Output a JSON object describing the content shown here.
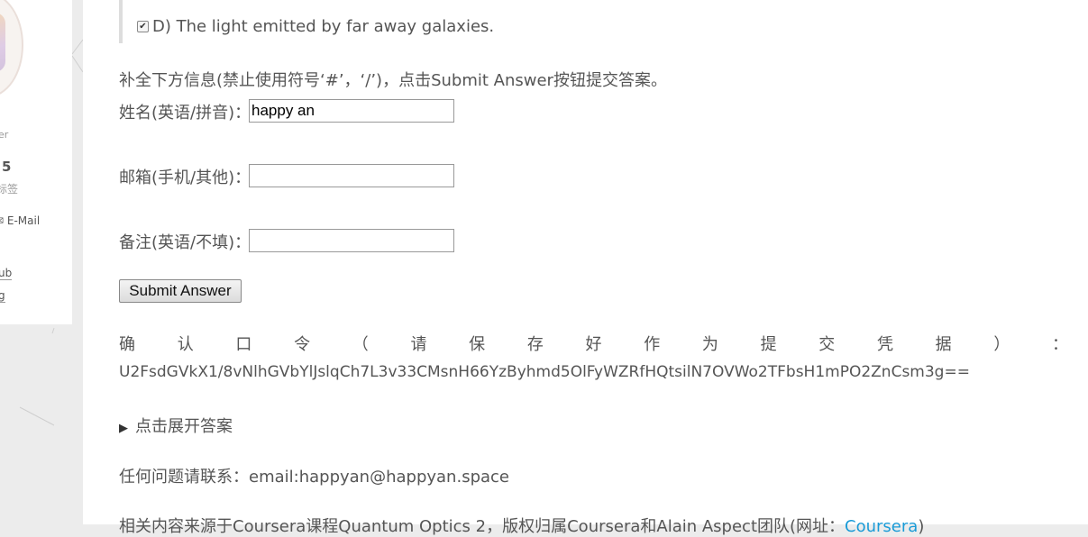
{
  "sidebar": {
    "fragment_role": "er",
    "tags_count": "5",
    "tags_label": "标签",
    "email_label": "E-Mail",
    "link_github": "ub",
    "link_blog": "g"
  },
  "question": {
    "option_d": "D) The light emitted by far away galaxies.",
    "option_d_checked": true
  },
  "form": {
    "instructions": "补全下方信息(禁止使用符号‘#’，‘/’)，点击Submit Answer按钮提交答案。",
    "name_label": "姓名(英语/拼音)：",
    "name_value": "happy an",
    "email_label": "邮箱(手机/其他)：",
    "email_value": "",
    "note_label": "备注(英语/不填)：",
    "note_value": "",
    "submit_label": "Submit Answer"
  },
  "confirm": {
    "label_chars": [
      "确",
      "认",
      "口",
      "令",
      "（",
      "请",
      "保",
      "存",
      "好",
      "作",
      "为",
      "提",
      "交",
      "凭",
      "据",
      "）",
      "："
    ],
    "token": "U2FsdGVkX1/8vNlhGVbYlJslqCh7L3v33CMsnH66YzByhmd5OlFyWZRfHQtsilN7OVWo2TFbsH1mPO2ZnCsm3g=="
  },
  "details": {
    "summary": "点击展开答案"
  },
  "contact": {
    "text": "任何问题请联系：email:happyan@happyan.space"
  },
  "footer": {
    "text": "相关内容来源于Coursera课程Quantum Optics 2，版权归属Coursera和Alain Aspect团队(网址：",
    "link_text": "Coursera",
    "closing": ")"
  },
  "colors": {
    "link": "#1a9bd7",
    "text": "#555555",
    "background": "#ececec"
  }
}
